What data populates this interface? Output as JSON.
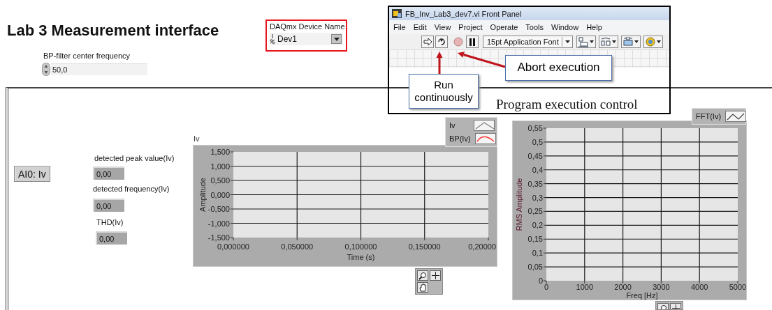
{
  "front_panel": {
    "title": "Lab 3 Measurement interface",
    "center_frequency": {
      "label": "BP-filter center frequency",
      "value": "50,0"
    },
    "device_name": {
      "label": "DAQmx Device Name",
      "value": "Dev1"
    },
    "channel_button": "AI0: Iv",
    "indicators": [
      {
        "label": "detected peak value(Iv)",
        "value": "0,00"
      },
      {
        "label": "detected frequency(Iv)",
        "value": "0,00"
      },
      {
        "label": "THD(Iv)",
        "value": "0,00"
      }
    ],
    "charts": [
      {
        "chart_data": {
          "type": "line",
          "title": "Iv",
          "xlabel": "Time (s)",
          "ylabel": "Amplitude",
          "series": [
            {
              "name": "Iv",
              "color": "#808080",
              "values": [
                null,
                null,
                null,
                null,
                null
              ]
            },
            {
              "name": "BP(Iv)",
              "color": "#ff3030",
              "values": [
                null,
                null,
                null,
                null,
                null
              ]
            }
          ],
          "categories": [
            "0,000000",
            "0,050000",
            "0,100000",
            "0,150000",
            "0,20000"
          ],
          "ylim": [
            -1.5,
            1.5
          ],
          "grid": true,
          "yticks": [
            {
              "value": -1.5,
              "label": "-1,500"
            },
            {
              "value": -1,
              "label": "-1,000"
            },
            {
              "value": -0.5,
              "label": "-0,500"
            },
            {
              "value": 0,
              "label": "0,000"
            },
            {
              "value": 0.5,
              "label": "0,500"
            },
            {
              "value": 1,
              "label": "1,000"
            },
            {
              "value": 1.5,
              "label": "1,500"
            }
          ]
        }
      },
      {
        "chart_data": {
          "type": "line",
          "xlabel": "Freq [Hz]",
          "ylabel": "RMS Amplitude",
          "series": [
            {
              "name": "FFT(Iv)",
              "color": "#404040",
              "values": [
                null,
                null,
                null,
                null,
                null,
                null
              ]
            }
          ],
          "categories": [
            "0",
            "1000",
            "2000",
            "3000",
            "4000",
            "5000"
          ],
          "ylim": [
            0,
            0.55
          ],
          "grid": true,
          "yticks": [
            {
              "value": 0,
              "label": "0"
            },
            {
              "value": 0.05,
              "label": "0,05"
            },
            {
              "value": 0.1,
              "label": "0,1"
            },
            {
              "value": 0.15,
              "label": "0,15"
            },
            {
              "value": 0.2,
              "label": "0,2"
            },
            {
              "value": 0.25,
              "label": "0,25"
            },
            {
              "value": 0.3,
              "label": "0,3"
            },
            {
              "value": 0.35,
              "label": "0,35"
            },
            {
              "value": 0.4,
              "label": "0,4"
            },
            {
              "value": 0.45,
              "label": "0,45"
            },
            {
              "value": 0.5,
              "label": "0,5"
            },
            {
              "value": 0.55,
              "label": "0,55"
            }
          ]
        }
      }
    ]
  },
  "execution_inset": {
    "window_title": "FB_Inv_Lab3_dev7.vi Front Panel",
    "menu": [
      "File",
      "Edit",
      "View",
      "Project",
      "Operate",
      "Tools",
      "Window",
      "Help"
    ],
    "font_selector": "15pt Application Font",
    "callouts": [
      {
        "text": "Abort execution"
      },
      {
        "text": "Run continuously"
      }
    ],
    "caption": "Program execution control"
  }
}
